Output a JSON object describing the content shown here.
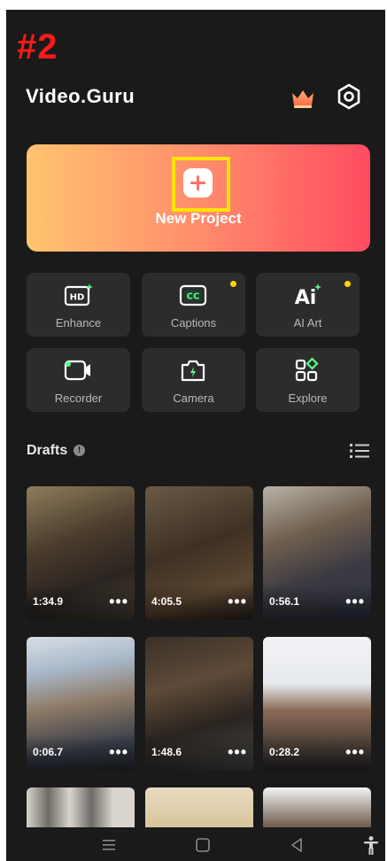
{
  "step_tag": "#2",
  "header": {
    "brand": "Video.Guru",
    "crown_icon": "crown-icon",
    "settings_icon": "gear-icon"
  },
  "new_project": {
    "label": "New Project",
    "icon": "plus-icon",
    "highlight_color": "#ffe600"
  },
  "tools": [
    {
      "label": "Enhance",
      "icon": "hd-icon",
      "badge": false
    },
    {
      "label": "Captions",
      "icon": "cc-icon",
      "badge": true
    },
    {
      "label": "AI Art",
      "icon": "ai-icon",
      "badge": true
    },
    {
      "label": "Recorder",
      "icon": "recorder-icon",
      "badge": false
    },
    {
      "label": "Camera",
      "icon": "camera-icon",
      "badge": false
    },
    {
      "label": "Explore",
      "icon": "explore-icon",
      "badge": false
    }
  ],
  "drafts": {
    "title": "Drafts",
    "items": [
      {
        "duration": "1:34.9",
        "more": "•••"
      },
      {
        "duration": "4:05.5",
        "more": "•••"
      },
      {
        "duration": "0:56.1",
        "more": "•••"
      },
      {
        "duration": "0:06.7",
        "more": "•••"
      },
      {
        "duration": "1:48.6",
        "more": "•••"
      },
      {
        "duration": "0:28.2",
        "more": "•••"
      }
    ]
  },
  "colors": {
    "background": "#1a1a1a",
    "tile": "#2c2c2c",
    "badge": "#ffd400",
    "gradient_start": "#ffc46f",
    "gradient_end": "#ff4c60",
    "step_tag": "#ff1a1a"
  }
}
